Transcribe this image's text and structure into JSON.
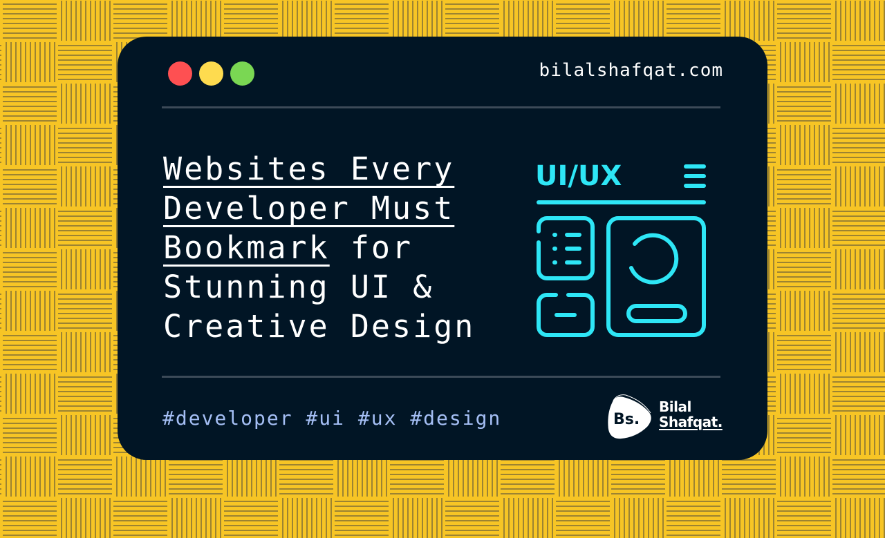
{
  "window": {
    "url": "bilalshafqat.com",
    "traffic_lights": [
      {
        "name": "close",
        "color": "#fe5052"
      },
      {
        "name": "minimize",
        "color": "#fedb4f"
      },
      {
        "name": "maximize",
        "color": "#7ad753"
      }
    ]
  },
  "headline": {
    "underlined_lines": [
      "Websites Every",
      "Developer Must",
      "Bookmark"
    ],
    "line3_rest": " for",
    "line4": "Stunning UI &",
    "line5": "Creative Design"
  },
  "illustration": {
    "label": "UI/UX",
    "icon": "ui-ux-wireframe-icon",
    "accent_color": "#2ee6f6"
  },
  "hashtags": "#developer #ui #ux #design",
  "logo": {
    "badge_text": "Bs.",
    "line1": "Bilal",
    "line2": "Shafqat."
  },
  "colors": {
    "background": "#f7c525",
    "window": "#011525",
    "divider": "#3c4a58",
    "hashtag": "#a5bff5"
  }
}
